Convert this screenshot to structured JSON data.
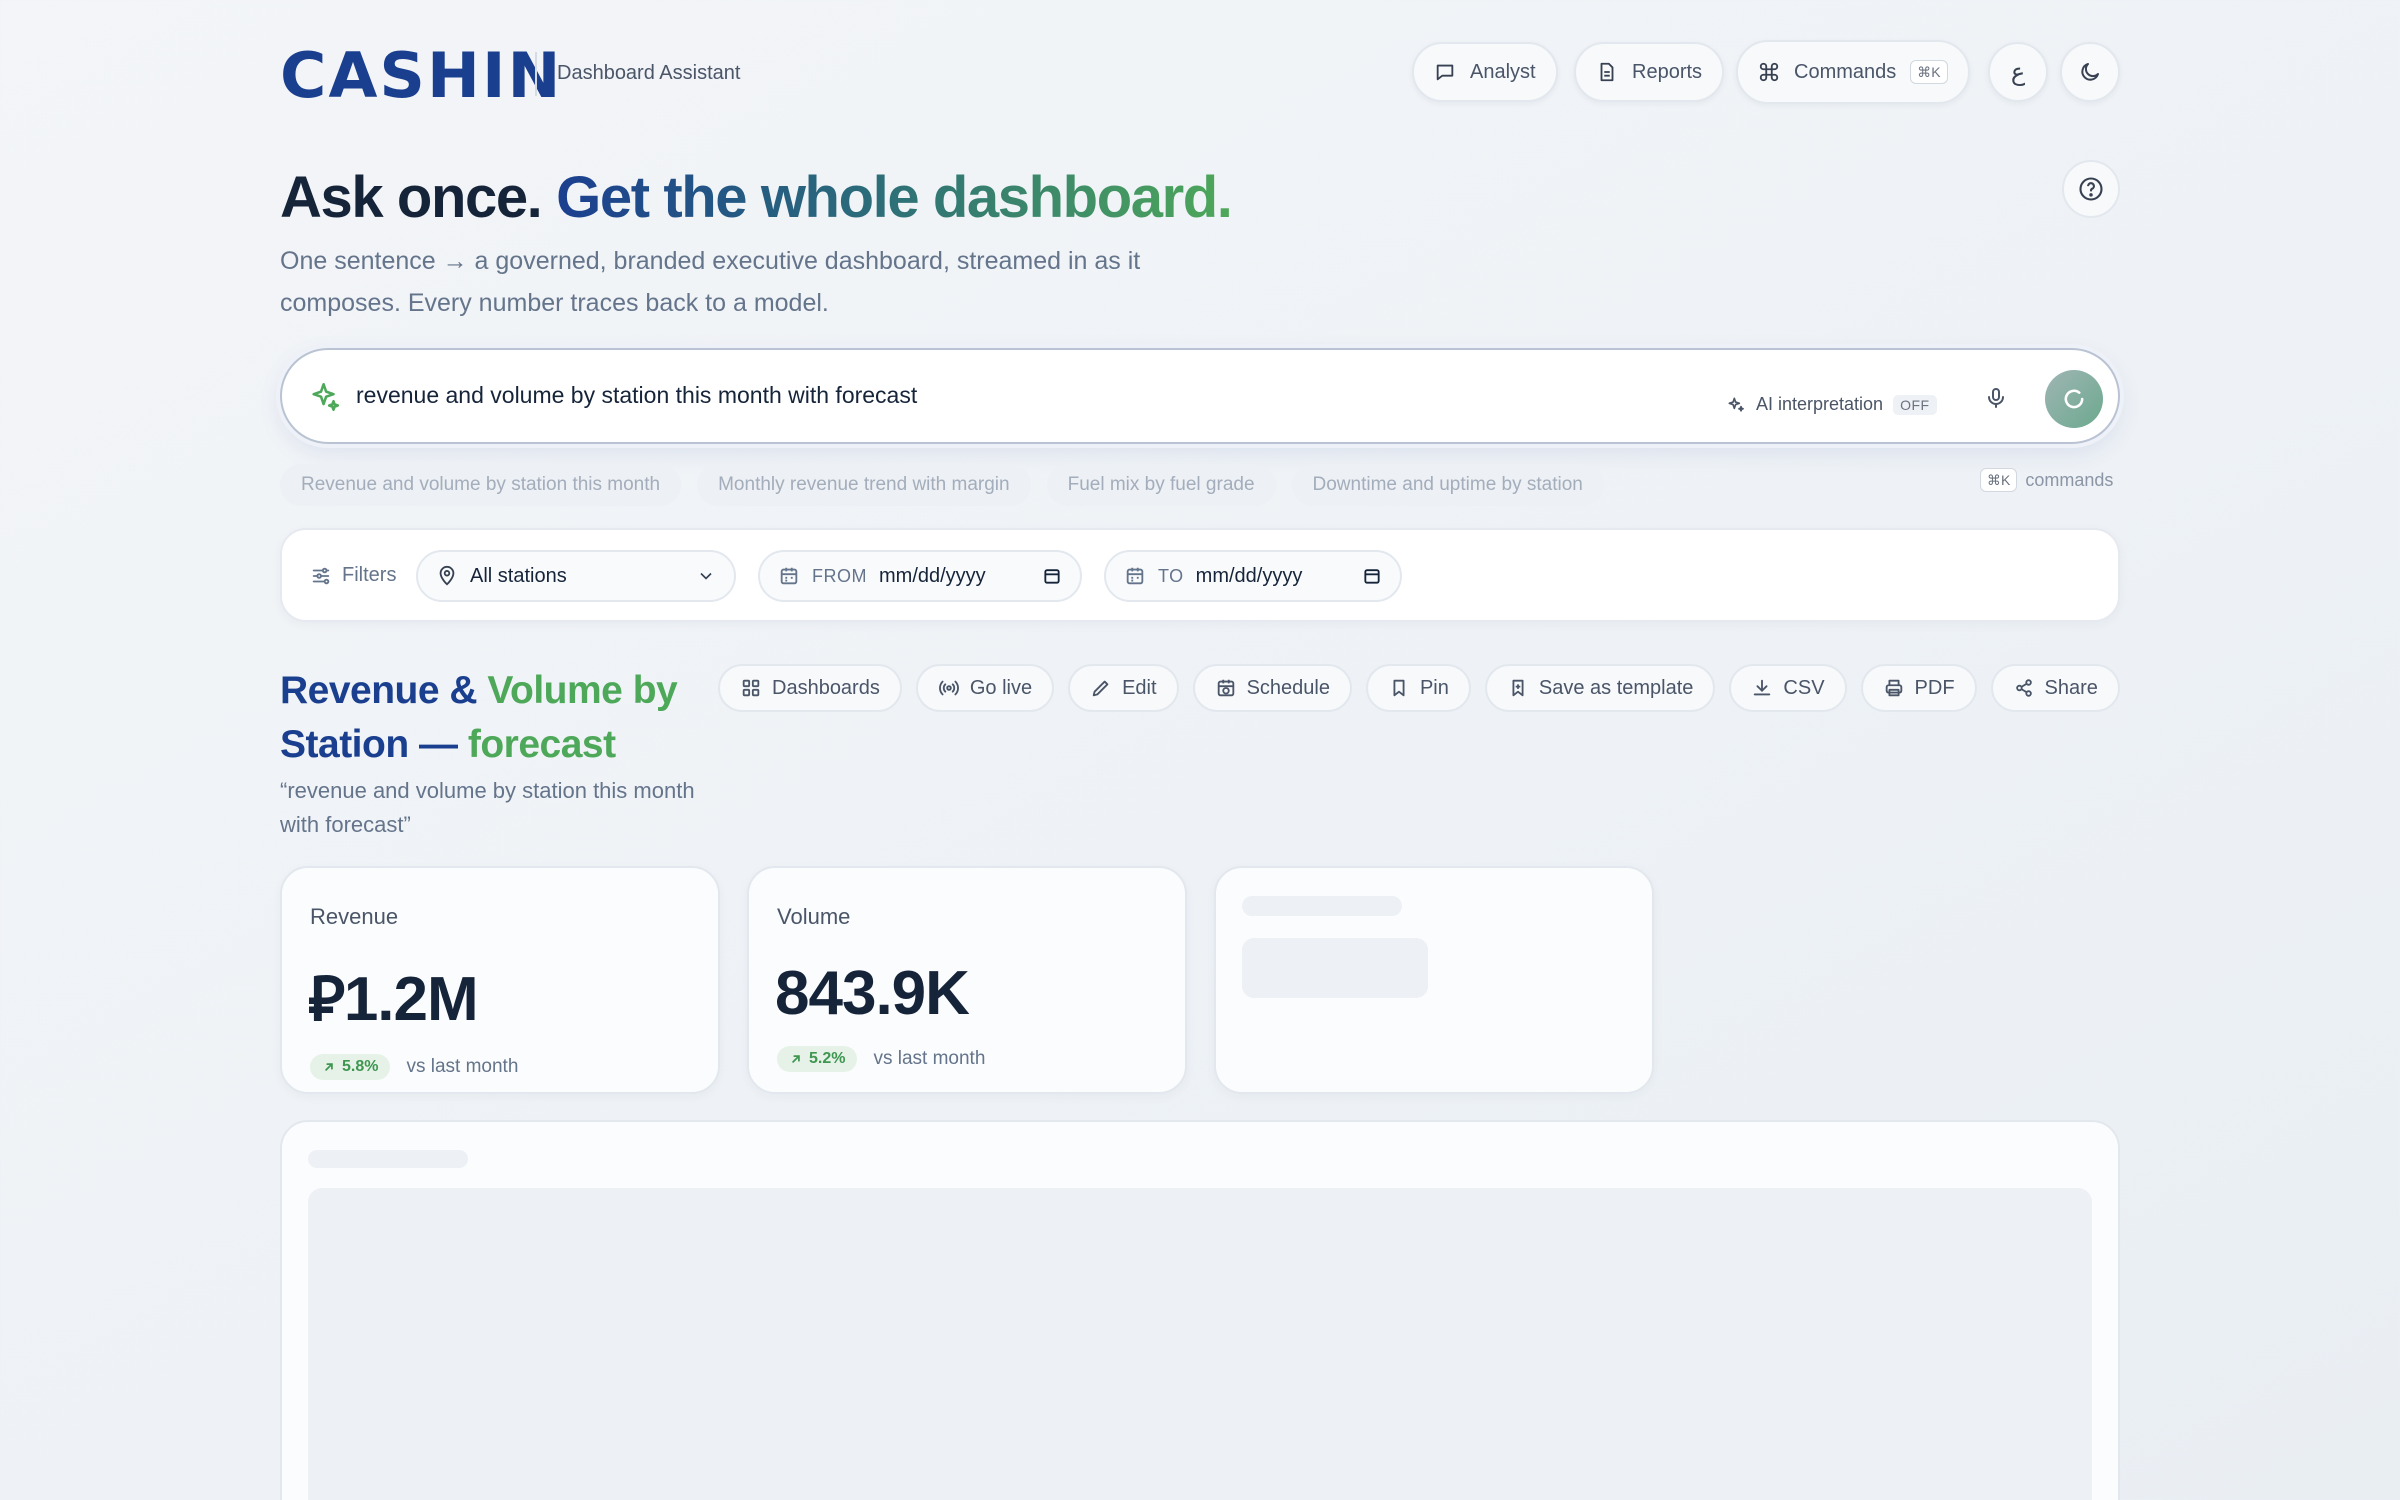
{
  "header": {
    "logo": "CASHIN",
    "subtitle": "Dashboard Assistant",
    "nav": [
      {
        "label": "Analyst",
        "icon": "chat-icon"
      },
      {
        "label": "Reports",
        "icon": "document-icon"
      },
      {
        "label": "Commands",
        "icon": "command-icon",
        "shortcut": "⌘K"
      }
    ],
    "lang_glyph": "ع",
    "theme_icon": "moon-icon"
  },
  "hero": {
    "title_part1": "Ask once.",
    "title_part2": "Get the whole dashboard.",
    "description": "One sentence → a governed, branded executive dashboard, streamed in as it composes. Every number traces back to a model."
  },
  "search": {
    "query": "revenue and volume by station this month with forecast",
    "ai_label": "AI interpretation",
    "ai_state": "OFF"
  },
  "suggestions": [
    "Revenue and volume by station this month",
    "Monthly revenue trend with margin",
    "Fuel mix by fuel grade",
    "Downtime and uptime by station"
  ],
  "commands_hint": {
    "shortcut": "⌘K",
    "label": "commands"
  },
  "filters": {
    "label": "Filters",
    "station": "All stations",
    "from_label": "FROM",
    "from_value": "mm/dd/yyyy",
    "to_label": "TO",
    "to_value": "mm/dd/yyyy"
  },
  "dashboard": {
    "title_a": "Revenue & ",
    "title_b": "Volume by",
    "title_c": "Station — ",
    "title_d": "forecast",
    "query_quote": "“revenue and volume by station this month with forecast”",
    "actions": [
      "Dashboards",
      "Go live",
      "Edit",
      "Schedule",
      "Pin",
      "Save as template",
      "CSV",
      "PDF",
      "Share"
    ]
  },
  "kpis": [
    {
      "label": "Revenue",
      "value": "⃁1.2M",
      "change": "5.8%",
      "compare": "vs last month"
    },
    {
      "label": "Volume",
      "value": "843.9K",
      "change": "5.2%",
      "compare": "vs last month"
    }
  ],
  "colors": {
    "brand": "#1b3f8f",
    "accent": "#4ea859",
    "text": "#16243a",
    "muted": "#64748b"
  }
}
